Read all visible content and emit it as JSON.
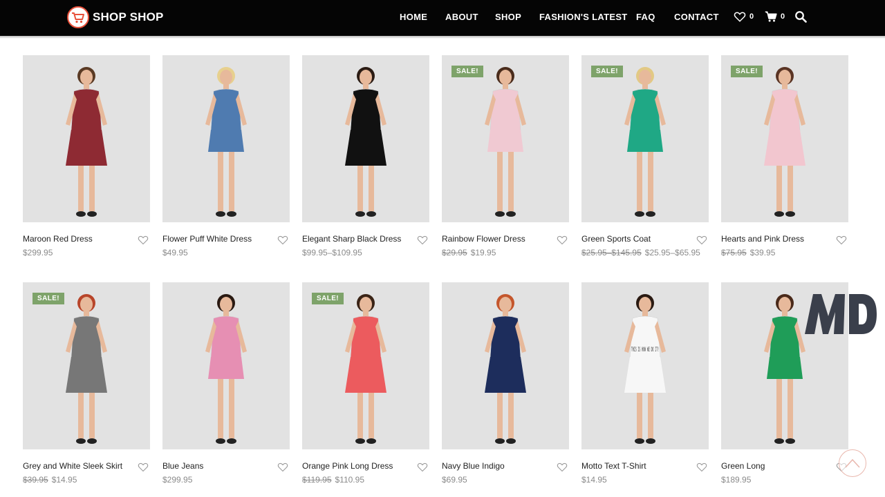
{
  "brand": {
    "name": "SHOP SHOP",
    "accent": "#e8503a"
  },
  "nav": [
    {
      "label": "HOME"
    },
    {
      "label": "ABOUT"
    },
    {
      "label": "SHOP"
    },
    {
      "label": "FASHION'S LATEST"
    },
    {
      "label": "FAQ"
    },
    {
      "label": "CONTACT"
    }
  ],
  "header_icons": {
    "wishlist": {
      "icon": "heart-icon",
      "count": "0"
    },
    "cart": {
      "icon": "cart-icon",
      "count": "0"
    },
    "search": {
      "icon": "search-icon"
    }
  },
  "sale_badge_text": "SALE!",
  "products": [
    {
      "name": "Maroon Red Dress",
      "sale": false,
      "old_price": "",
      "price": "$299.95",
      "dress": "#8e2a33"
    },
    {
      "name": "Flower Puff White Dress",
      "sale": false,
      "old_price": "",
      "price": "$49.95",
      "dress": "#4f7bb0"
    },
    {
      "name": "Elegant Sharp Black Dress",
      "sale": false,
      "old_price": "",
      "price": "$99.95–$109.95",
      "dress": "#111111"
    },
    {
      "name": "Rainbow Flower Dress",
      "sale": true,
      "old_price": "$29.95",
      "price": "$19.95",
      "dress": "#f0c9d2"
    },
    {
      "name": "Green Sports Coat",
      "sale": true,
      "old_price": "$25.95–$145.95",
      "price": "$25.95–$65.95",
      "dress": "#1fa885"
    },
    {
      "name": "Hearts and Pink Dress",
      "sale": true,
      "old_price": "$75.95",
      "price": "$39.95",
      "dress": "#f2c6cf"
    },
    {
      "name": "Grey and White Sleek Skirt",
      "sale": true,
      "old_price": "$39.95",
      "price": "$14.95",
      "dress": "#777777"
    },
    {
      "name": "Blue Jeans",
      "sale": false,
      "old_price": "",
      "price": "$299.95",
      "dress": "#e68fb3"
    },
    {
      "name": "Orange Pink Long Dress",
      "sale": true,
      "old_price": "$119.95",
      "price": "$110.95",
      "dress": "#ec5b5e"
    },
    {
      "name": "Navy Blue Indigo",
      "sale": false,
      "old_price": "",
      "price": "$69.95",
      "dress": "#1d2d5c"
    },
    {
      "name": "Motto Text T-Shirt",
      "sale": false,
      "old_price": "",
      "price": "$14.95",
      "dress": "#f7f7f7"
    },
    {
      "name": "Green Long",
      "sale": false,
      "old_price": "",
      "price": "$189.95",
      "dress": "#1f9d58"
    }
  ],
  "motto_text": "THIS IS HOW WE DO IT!",
  "watermark": "MD"
}
